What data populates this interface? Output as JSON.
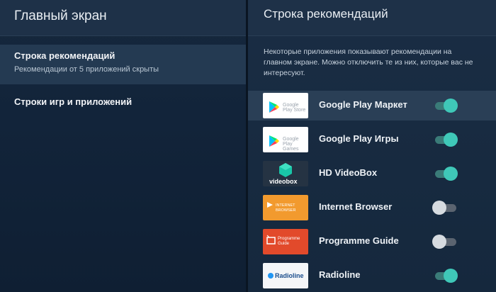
{
  "left_panel": {
    "title": "Главный экран",
    "items": [
      {
        "title": "Строка рекомендаций",
        "subtitle": "Рекомендации от 5 приложений скрыты"
      },
      {
        "title": "Строки игр и приложений"
      }
    ]
  },
  "right_panel": {
    "title": "Строка рекомендаций",
    "description": "Некоторые приложения показывают рекомендации на главном экране. Можно отключить те из них, которые вас не интересуют.",
    "apps": [
      {
        "name": "Google Play Маркет",
        "enabled": true,
        "thumb_icon": "google-play-store-logo",
        "thumb_caption": "Google Play Store"
      },
      {
        "name": "Google Play Игры",
        "enabled": true,
        "thumb_icon": "google-play-games-logo",
        "thumb_caption": "Google Play Games"
      },
      {
        "name": "HD VideoBox",
        "enabled": true,
        "thumb_icon": "videobox-cube-logo",
        "thumb_caption": "videobox"
      },
      {
        "name": "Internet Browser",
        "enabled": false,
        "thumb_icon": "browser-logo",
        "thumb_caption": "INTERNET BROWSER"
      },
      {
        "name": "Programme Guide",
        "enabled": false,
        "thumb_icon": "programme-guide-logo",
        "thumb_caption": "Programme Guide"
      },
      {
        "name": "Radioline",
        "enabled": true,
        "thumb_icon": "radioline-logo",
        "thumb_caption": "Radioline"
      }
    ]
  },
  "colors": {
    "toggle_on": "#3fc8b8",
    "toggle_off": "#d6dbe0",
    "background": "#15283d"
  }
}
